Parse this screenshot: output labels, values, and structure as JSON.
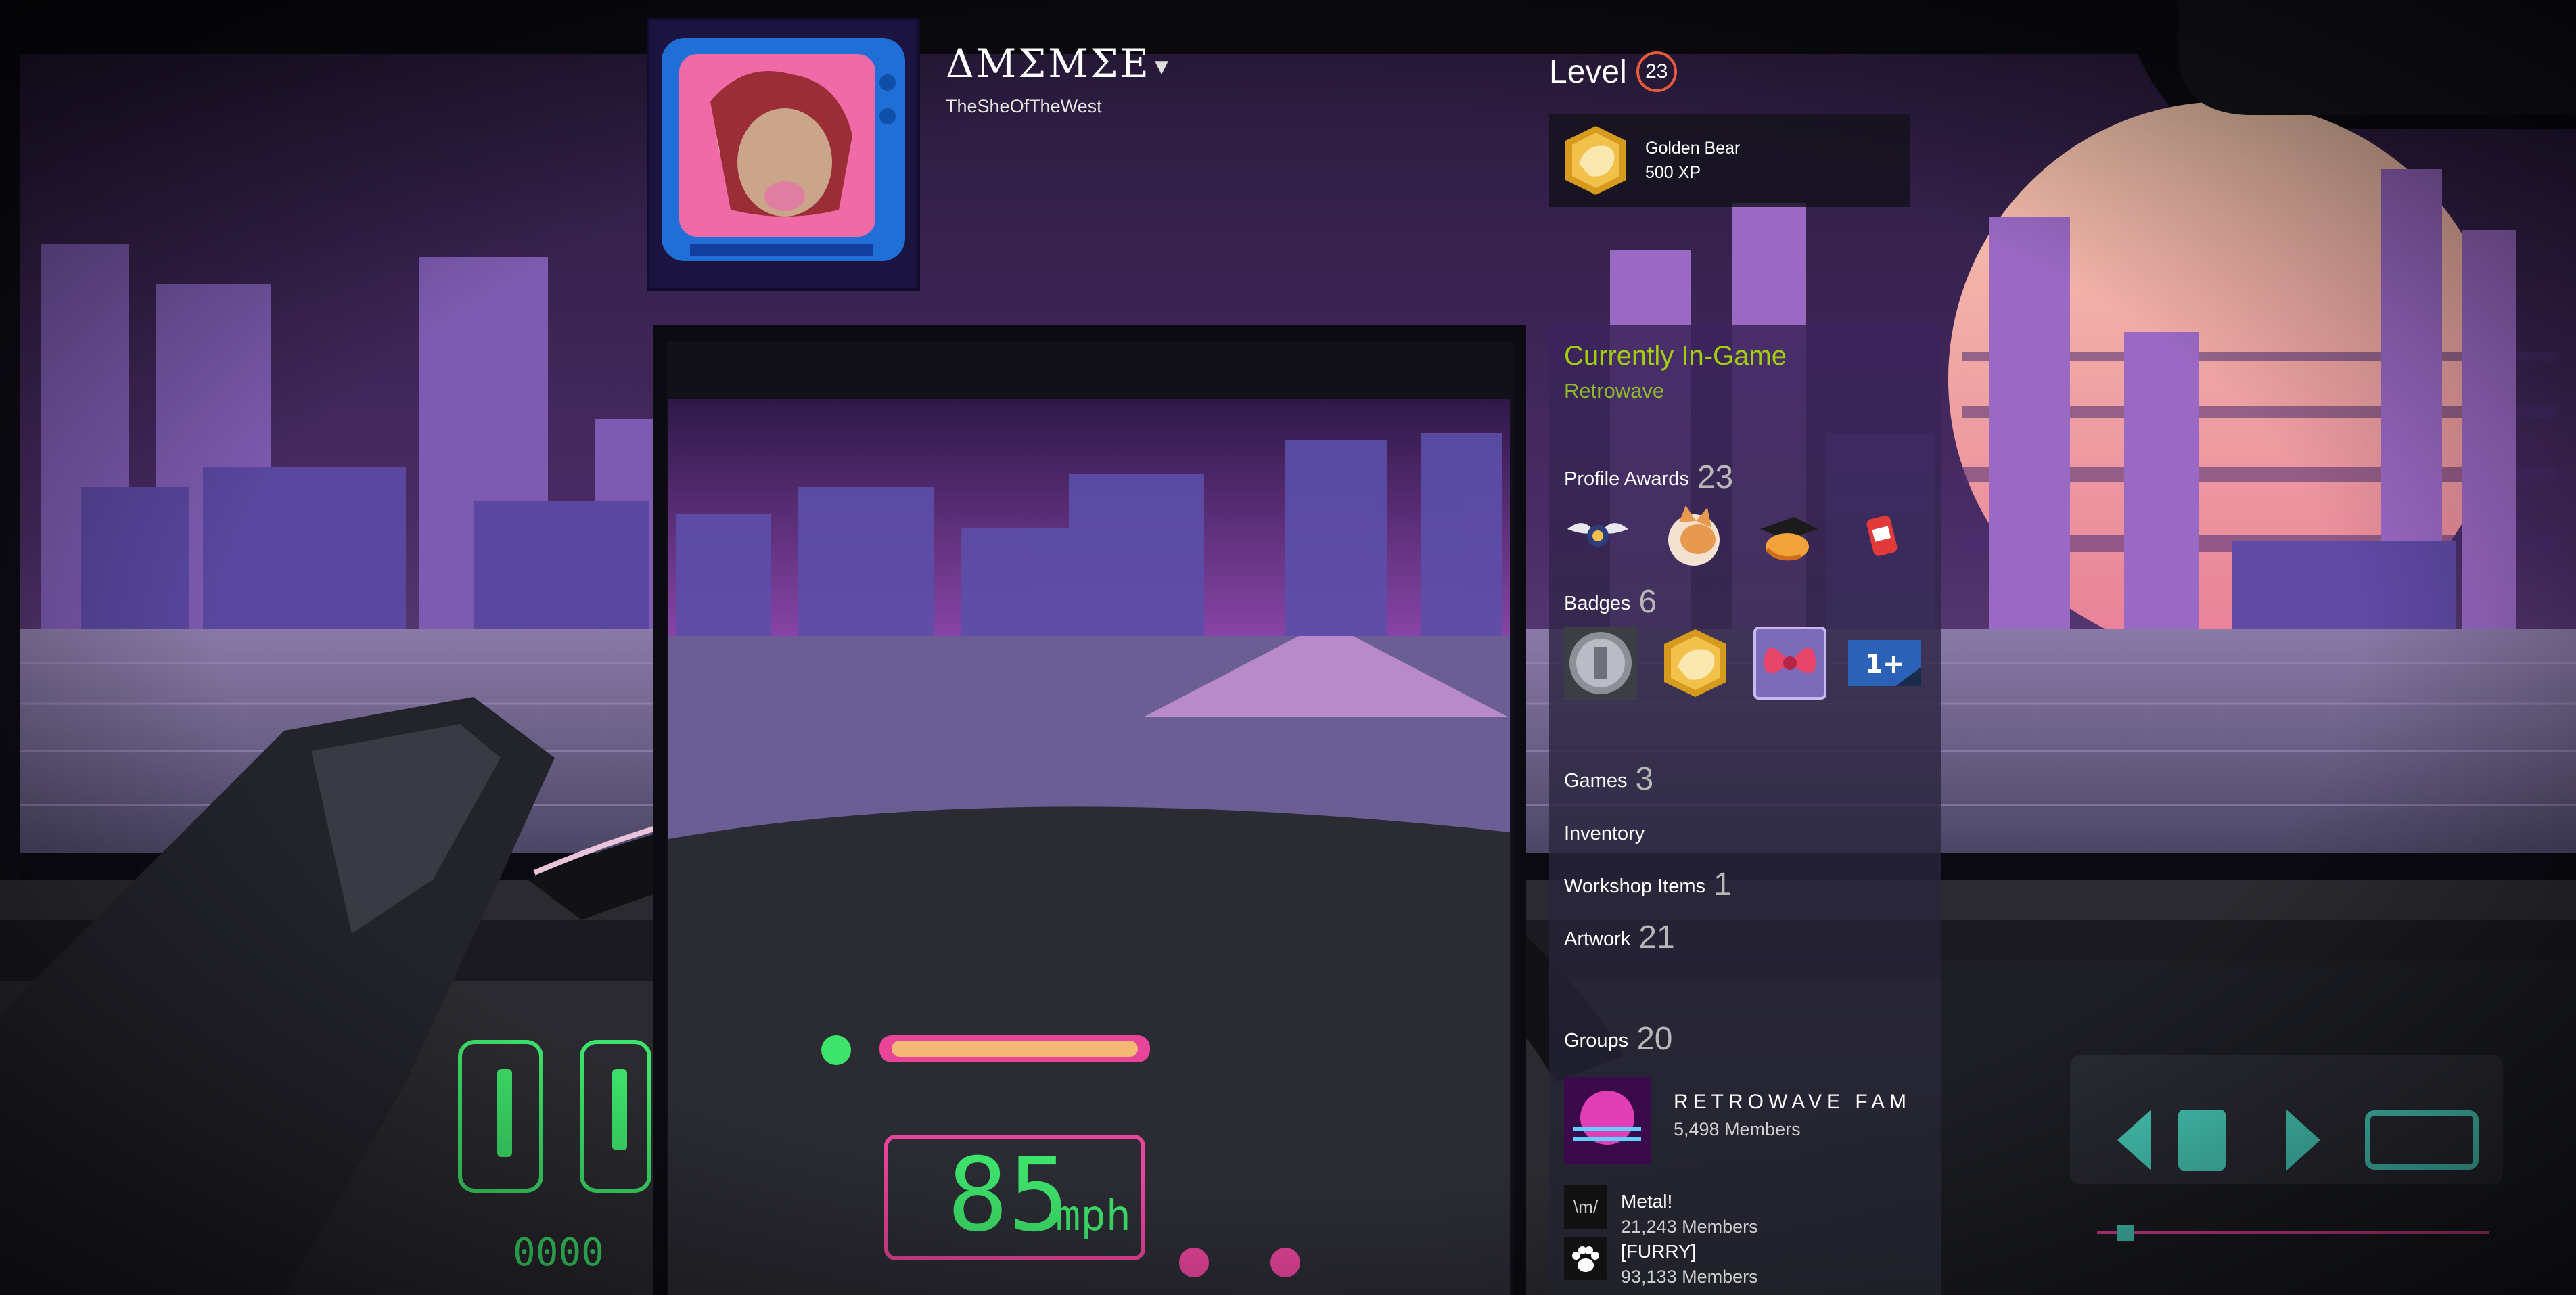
{
  "profile": {
    "persona_name": "ΔΜΣΜΣΕ",
    "account_name": "TheSheOfTheWest",
    "level_label": "Level",
    "level": "23"
  },
  "favorite_badge": {
    "icon": "golden-bear-icon",
    "name": "Golden Bear",
    "xp": "500 XP"
  },
  "status": {
    "title": "Currently In-Game",
    "game": "Retrowave"
  },
  "sections": {
    "profile_awards": {
      "label": "Profile Awards",
      "count": "23",
      "icons": [
        "winged-badge-icon",
        "fox-icon",
        "mortarboard-cat-icon",
        "soda-can-icon"
      ]
    },
    "badges": {
      "label": "Badges",
      "count": "6",
      "icons": [
        "silver-coin-badge-icon",
        "golden-bear-icon",
        "red-bow-badge-icon",
        "years-of-service-badge-icon"
      ],
      "years_text": "1+"
    },
    "games": {
      "label": "Games",
      "count": "3"
    },
    "inventory": {
      "label": "Inventory"
    },
    "workshop": {
      "label": "Workshop Items",
      "count": "1"
    },
    "artwork": {
      "label": "Artwork",
      "count": "21"
    },
    "groups": {
      "label": "Groups",
      "count": "20"
    }
  },
  "groups": [
    {
      "name": "RETROWAVE FAM",
      "members": "5,498 Members",
      "icon": "retrowave-fam-avatar"
    },
    {
      "name": "Metal!",
      "members": "21,243 Members",
      "icon_text": "\\m/"
    },
    {
      "name": "[FURRY]",
      "members": "93,133 Members",
      "icon": "paw-icon"
    }
  ],
  "dashboard": {
    "speed": "85",
    "unit": "mph",
    "odometer": "0000"
  },
  "colors": {
    "accent_green": "#a3cf06",
    "level_ring": "#e55b3c",
    "neon_green": "#3ee36b",
    "neon_pink": "#e8459a",
    "sky_purple": "#6b3f8f"
  }
}
